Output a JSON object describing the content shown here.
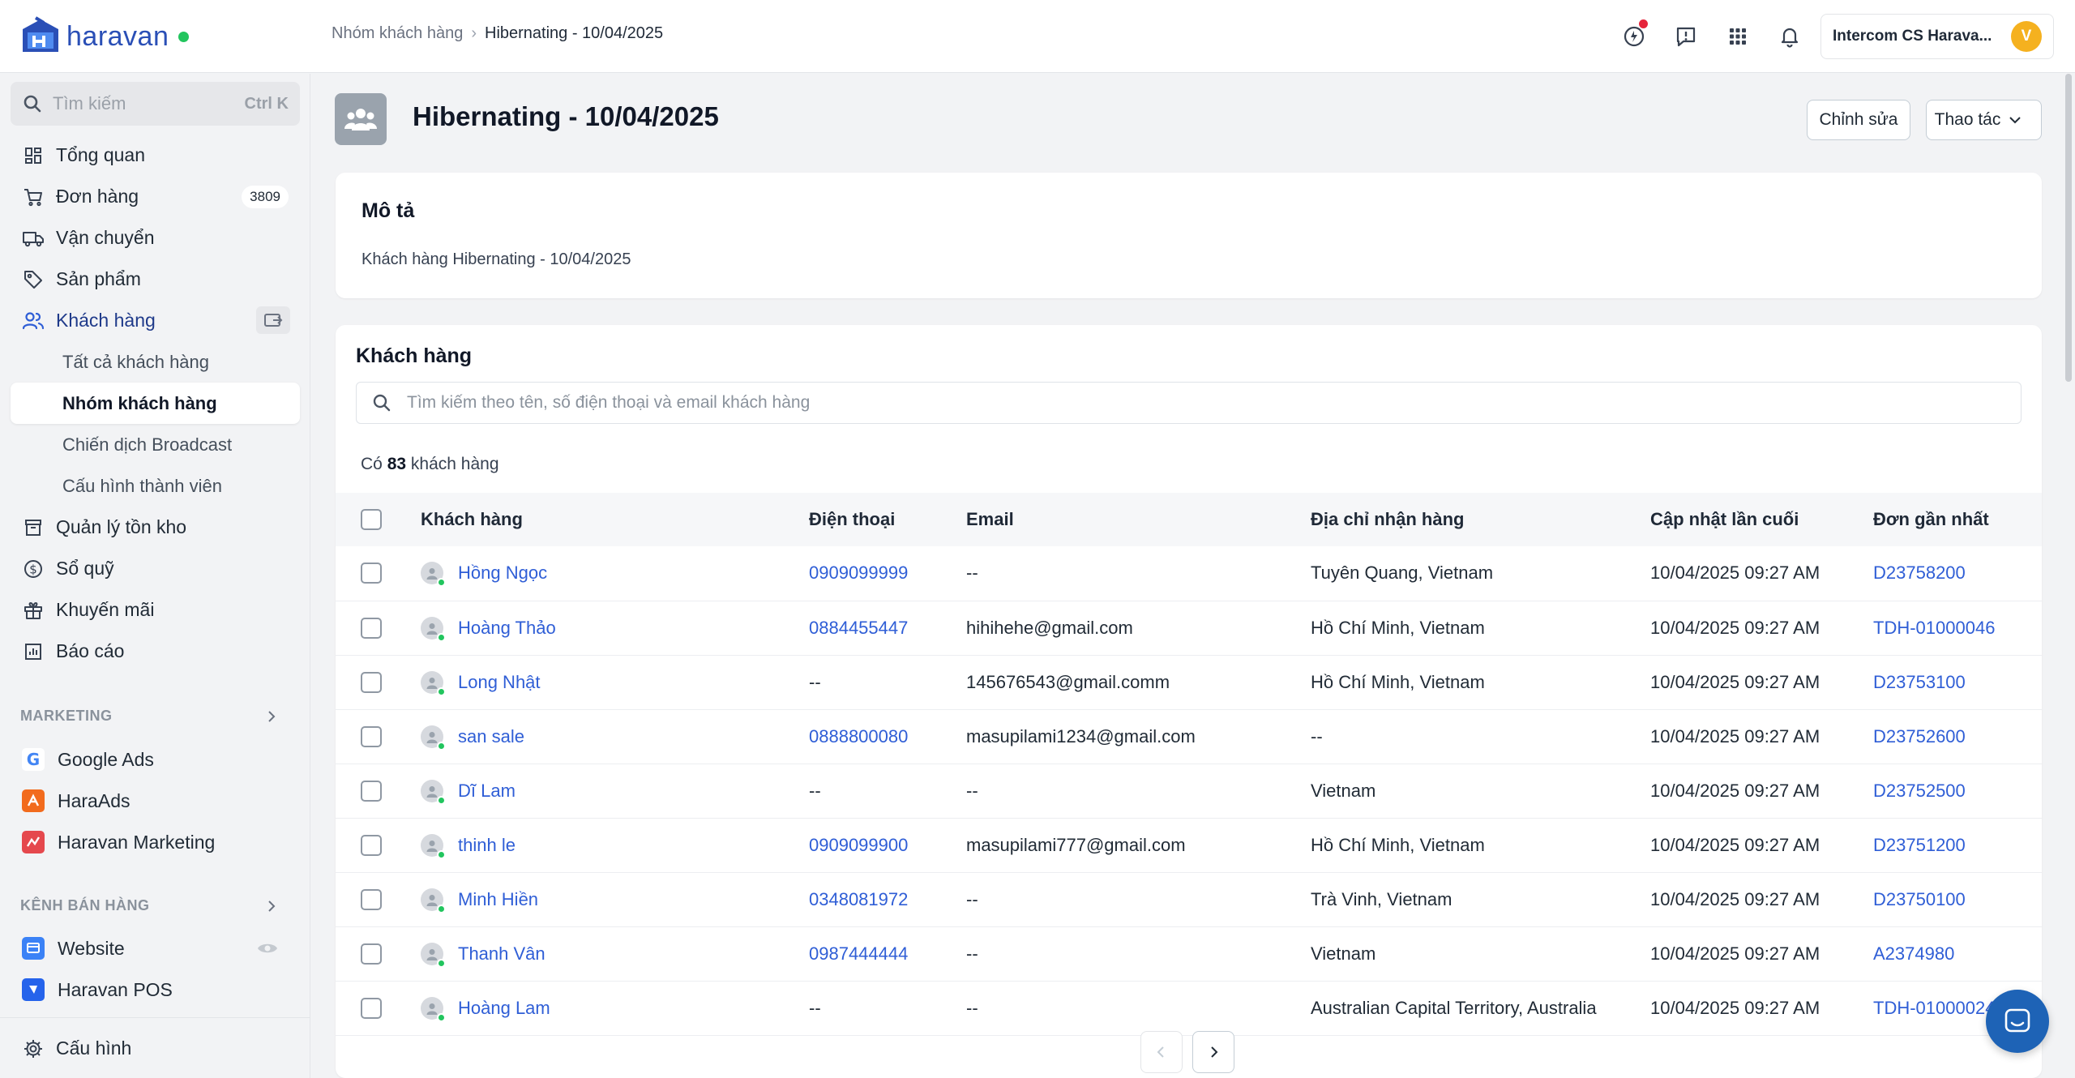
{
  "header": {
    "logo_text": "haravan",
    "breadcrumb_parent": "Nhóm khách hàng",
    "breadcrumb_current": "Hibernating - 10/04/2025",
    "account_name": "Intercom CS Harava...",
    "account_initial": "V"
  },
  "sidebar": {
    "search_placeholder": "Tìm kiếm",
    "search_shortcut": "Ctrl K",
    "items": [
      {
        "label": "Tổng quan",
        "icon": "dashboard-icon"
      },
      {
        "label": "Đơn hàng",
        "icon": "cart-icon",
        "badge": "3809"
      },
      {
        "label": "Vận chuyển",
        "icon": "truck-icon"
      },
      {
        "label": "Sản phẩm",
        "icon": "tag-icon"
      },
      {
        "label": "Khách hàng",
        "icon": "users-icon"
      }
    ],
    "customer_sub_items": [
      {
        "label": "Tất cả khách hàng"
      },
      {
        "label": "Nhóm khách hàng"
      },
      {
        "label": "Chiến dịch Broadcast"
      },
      {
        "label": "Cấu hình thành viên"
      }
    ],
    "items_after": [
      {
        "label": "Quản lý tồn kho",
        "icon": "archive-icon"
      },
      {
        "label": "Sổ quỹ",
        "icon": "dollar-icon"
      },
      {
        "label": "Khuyến mãi",
        "icon": "gift-icon"
      },
      {
        "label": "Báo cáo",
        "icon": "chart-icon"
      }
    ],
    "marketing_title": "MARKETING",
    "marketing_apps": [
      {
        "label": "Google Ads"
      },
      {
        "label": "HaraAds"
      },
      {
        "label": "Haravan Marketing"
      }
    ],
    "sales_channels_title": "KÊNH BÁN HÀNG",
    "sales_channels": [
      {
        "label": "Website"
      },
      {
        "label": "Haravan POS"
      }
    ],
    "settings_label": "Cấu hình"
  },
  "page": {
    "title": "Hibernating - 10/04/2025",
    "edit_button": "Chỉnh sửa",
    "actions_button": "Thao tác"
  },
  "description_card": {
    "title": "Mô tả",
    "text": "Khách hàng Hibernating - 10/04/2025"
  },
  "customers_card": {
    "title": "Khách hàng",
    "search_placeholder": "Tìm kiếm theo tên, số điện thoại và email khách hàng",
    "count_prefix": "Có",
    "count": "83",
    "count_suffix": "khách hàng",
    "columns": [
      "Khách hàng",
      "Điện thoại",
      "Email",
      "Địa chỉ nhận hàng",
      "Cập nhật lần cuối",
      "Đơn gần nhất"
    ],
    "rows": [
      {
        "name": "Hồng Ngọc",
        "phone": "0909099999",
        "email": "--",
        "address": "Tuyên Quang, Vietnam",
        "updated": "10/04/2025 09:27 AM",
        "order": "D23758200"
      },
      {
        "name": "Hoàng Thảo",
        "phone": "0884455447",
        "email": "hihihehe@gmail.com",
        "address": "Hồ Chí Minh, Vietnam",
        "updated": "10/04/2025 09:27 AM",
        "order": "TDH-01000046"
      },
      {
        "name": "Long Nhật",
        "phone": "--",
        "email": "145676543@gmail.comm",
        "address": "Hồ Chí Minh, Vietnam",
        "updated": "10/04/2025 09:27 AM",
        "order": "D23753100"
      },
      {
        "name": "san sale",
        "phone": "0888800080",
        "email": "masupilami1234@gmail.com",
        "address": "--",
        "updated": "10/04/2025 09:27 AM",
        "order": "D23752600"
      },
      {
        "name": "Dĩ Lam",
        "phone": "--",
        "email": "--",
        "address": "Vietnam",
        "updated": "10/04/2025 09:27 AM",
        "order": "D23752500"
      },
      {
        "name": "thinh le",
        "phone": "0909099900",
        "email": "masupilami777@gmail.com",
        "address": "Hồ Chí Minh, Vietnam",
        "updated": "10/04/2025 09:27 AM",
        "order": "D23751200"
      },
      {
        "name": "Minh Hiền",
        "phone": "0348081972",
        "email": "--",
        "address": "Trà Vinh, Vietnam",
        "updated": "10/04/2025 09:27 AM",
        "order": "D23750100"
      },
      {
        "name": "Thanh Vân",
        "phone": "0987444444",
        "email": "--",
        "address": "Vietnam",
        "updated": "10/04/2025 09:27 AM",
        "order": "A2374980"
      },
      {
        "name": "Hoàng Lam",
        "phone": "--",
        "email": "--",
        "address": "Australian Capital Territory, Australia",
        "updated": "10/04/2025 09:27 AM",
        "order": "TDH-01000024"
      }
    ]
  },
  "colors": {
    "brand": "#2a4fb6",
    "link": "#2f5ed6",
    "online": "#22c55e",
    "avatar": "#f5b11f",
    "chat": "#1e63b6"
  }
}
